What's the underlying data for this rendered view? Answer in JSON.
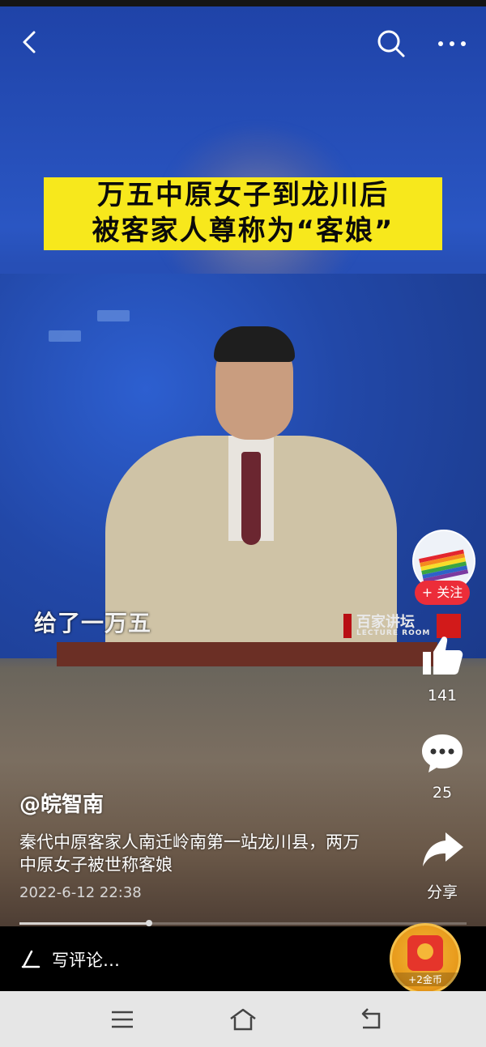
{
  "video": {
    "banner_line1": "万五中原女子到龙川后",
    "banner_line2": "被客家人尊称为“客娘”",
    "subtitle": "给了一万五",
    "watermark": "百家讲坛",
    "watermark_sub": "LECTURE ROOM",
    "progress": 0.29
  },
  "top_bar": {
    "back_icon": "back-arrow-icon",
    "search_icon": "search-icon",
    "more_icon": "more-dots-icon"
  },
  "side": {
    "follow_label": "+ 关注",
    "like_count": "141",
    "comment_count": "25",
    "share_label": "分享"
  },
  "info": {
    "author": "@皖智南",
    "caption": "秦代中原客家人南迁岭南第一站龙川县，两万中原女子被世称客娘",
    "date": "2022-6-12  22:38"
  },
  "comment_bar": {
    "placeholder": "写评论…",
    "coin_label": "+2金币"
  },
  "colors": {
    "banner_bg": "#f7e81c",
    "follow_bg": "#ec2d39",
    "coin_gold": "#f5c04a"
  }
}
